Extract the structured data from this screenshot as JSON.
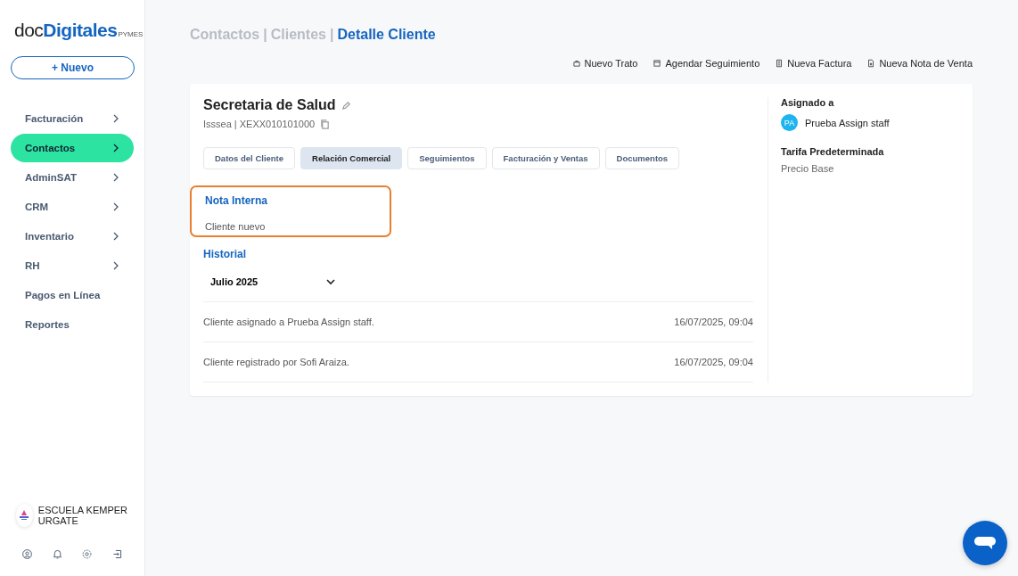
{
  "sidebar": {
    "logo": {
      "light": "doc",
      "bold": "Digitales",
      "suffix": "PYMES"
    },
    "new_button": {
      "icon": "+",
      "label": "Nuevo"
    },
    "items": [
      {
        "label": "Facturación",
        "selected": false,
        "has_submenu": true
      },
      {
        "label": "Contactos",
        "selected": true,
        "has_submenu": true
      },
      {
        "label": "AdminSAT",
        "selected": false,
        "has_submenu": true
      },
      {
        "label": "CRM",
        "selected": false,
        "has_submenu": true
      },
      {
        "label": "Inventario",
        "selected": false,
        "has_submenu": true
      },
      {
        "label": "RH",
        "selected": false,
        "has_submenu": true
      },
      {
        "label": "Pagos en Línea",
        "selected": false,
        "has_submenu": false
      },
      {
        "label": "Reportes",
        "selected": false,
        "has_submenu": false
      }
    ],
    "account": {
      "name": "ESCUELA KEMPER URGATE"
    },
    "footer_icons": [
      {
        "kind": "profile"
      },
      {
        "kind": "notifications"
      },
      {
        "kind": "settings"
      },
      {
        "kind": "logout"
      }
    ]
  },
  "breadcrumb": {
    "separator": "|",
    "items": [
      {
        "label": "Contactos",
        "current": false
      },
      {
        "label": "Clientes",
        "current": false
      },
      {
        "label": "Detalle Cliente",
        "current": true
      }
    ]
  },
  "actions": [
    {
      "kind": "deal",
      "label": "Nuevo Trato"
    },
    {
      "kind": "calendar",
      "label": "Agendar Seguimiento"
    },
    {
      "kind": "invoice",
      "label": "Nueva Factura"
    },
    {
      "kind": "note",
      "label": "Nueva Nota de Venta"
    }
  ],
  "client": {
    "name": "Secretaria de Salud",
    "subtitle": "Isssea | XEXX010101000"
  },
  "tabs": [
    {
      "label": "Datos del Cliente",
      "selected": false
    },
    {
      "label": "Relación Comercial",
      "selected": true
    },
    {
      "label": "Seguimientos",
      "selected": false
    },
    {
      "label": "Facturación y Ventas",
      "selected": false
    },
    {
      "label": "Documentos",
      "selected": false
    }
  ],
  "internal_note": {
    "title": "Nota Interna",
    "text": "Cliente nuevo",
    "highlighted": true
  },
  "history": {
    "title": "Historial",
    "period": "Julio 2025",
    "entries": [
      {
        "text": "Cliente asignado a Prueba Assign staff.",
        "date": "16/07/2025, 09:04"
      },
      {
        "text": "Cliente registrado por Sofi Araiza.",
        "date": "16/07/2025, 09:04"
      }
    ]
  },
  "assigned": {
    "title": "Asignado a",
    "initials": "PA",
    "name": "Prueba Assign staff"
  },
  "rate": {
    "title": "Tarifa Predeterminada",
    "value": "Precio Base"
  }
}
